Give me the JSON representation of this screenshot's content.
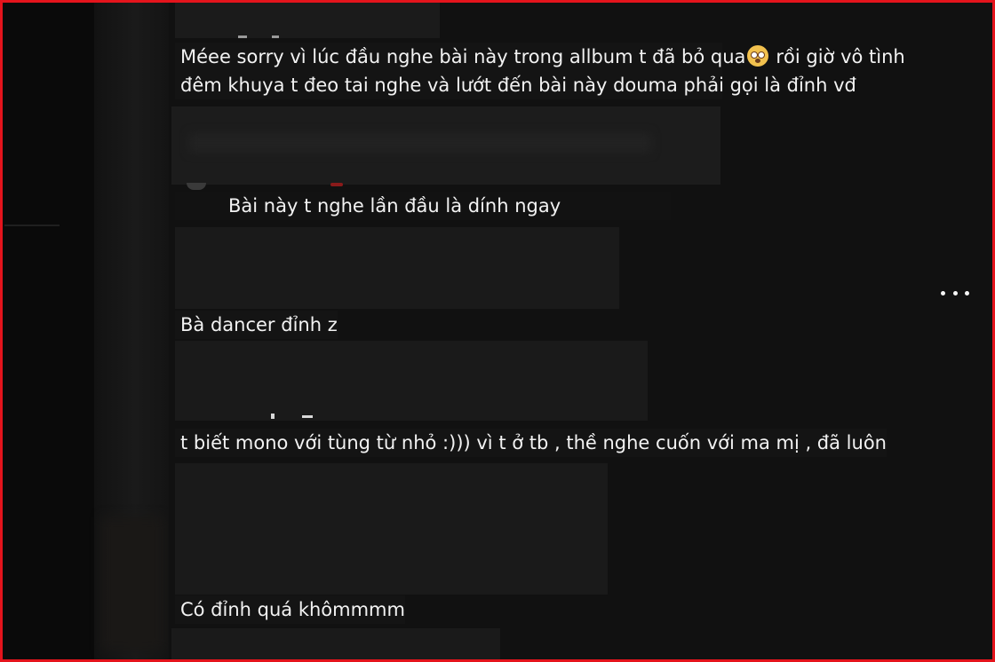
{
  "comments": [
    {
      "lines": [
        "Méee sorry vì lúc đầu nghe bài này trong allbum t đã bỏ qua",
        "rồi giờ vô tình",
        "đêm khuya t đeo tai nghe và lướt đến bài này douma phải gọi là đỉnh vđ"
      ],
      "emoji": "flushed-face-emoji"
    },
    {
      "text": "Bài này t nghe lần đầu là dính ngay"
    },
    {
      "text": "Bà dancer đỉnh z"
    },
    {
      "text": "t biết mono với tùng từ nhỏ :))) vì t ở tb , thề nghe cuốn với ma mị , đã luôn"
    },
    {
      "text": "Có đỉnh quá khômmmm"
    }
  ],
  "more_button": {
    "icon": "more-horizontal-icon"
  },
  "colors": {
    "frame": "#e4141c",
    "text": "#f2f2f2",
    "background": "#111111"
  }
}
